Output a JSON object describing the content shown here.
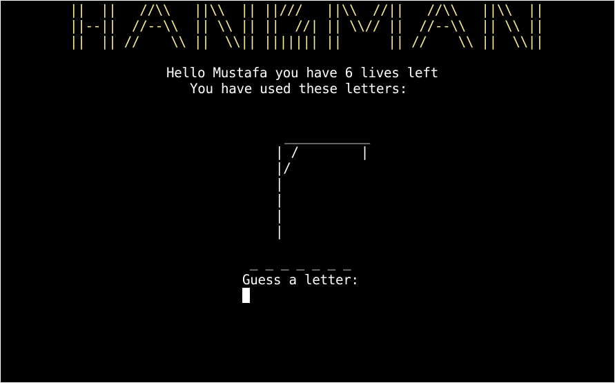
{
  "banner": {
    "line1": "||  ||   //\\\\   ||\\\\  || ||///   ||\\\\  //||   //\\\\   ||\\\\  ||",
    "line2": "||--||  //--\\\\  || \\\\ || ||  //| || \\\\// ||  //--\\\\  || \\\\ ||",
    "line3": "||  || //    \\\\ ||  \\\\|| ||||||| ||      || //    \\\\ ||  \\\\||"
  },
  "status": {
    "greeting": "Hello Mustafa you have 6 lives left",
    "used_letters": "You have used these letters:"
  },
  "gallows": {
    "row0": " ___________",
    "row1": "| /        |",
    "row2": "|/",
    "row3": "|",
    "row4": "|",
    "row5": "|",
    "row6": "|"
  },
  "word": {
    "blanks": "_ _ _ _ _ _ _"
  },
  "prompt": {
    "label": "Guess a letter:"
  },
  "colors": {
    "background": "#000000",
    "banner": "#f7e99b",
    "text": "#ffffff",
    "frame": "#ffffff"
  }
}
